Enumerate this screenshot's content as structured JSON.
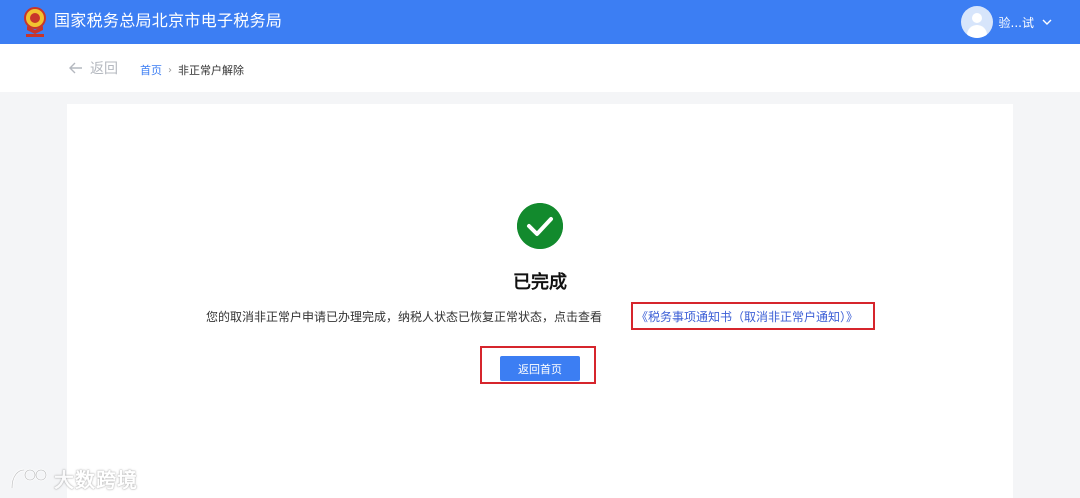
{
  "header": {
    "title": "国家税务总局北京市电子税务局",
    "user_name": "验...试",
    "brand_color": "#3c7ef3",
    "emblem_icon": "tax-emblem-icon",
    "avatar_icon": "user-avatar-icon",
    "dropdown_icon": "chevron-down-icon"
  },
  "breadcrumb": {
    "back_label": "返回",
    "home": "首页",
    "separator": "›",
    "current": "非正常户解除"
  },
  "result": {
    "status_icon": "success-check-icon",
    "status_color": "#128a2d",
    "title": "已完成",
    "message": "您的取消非正常户申请已办理完成，纳税人状态已恢复正常状态，点击查看",
    "notice_link": "《税务事项通知书（取消非正常户通知）》",
    "home_button": "返回首页"
  },
  "watermark": {
    "text": "大数跨境"
  },
  "highlight_color": "#d6252c"
}
